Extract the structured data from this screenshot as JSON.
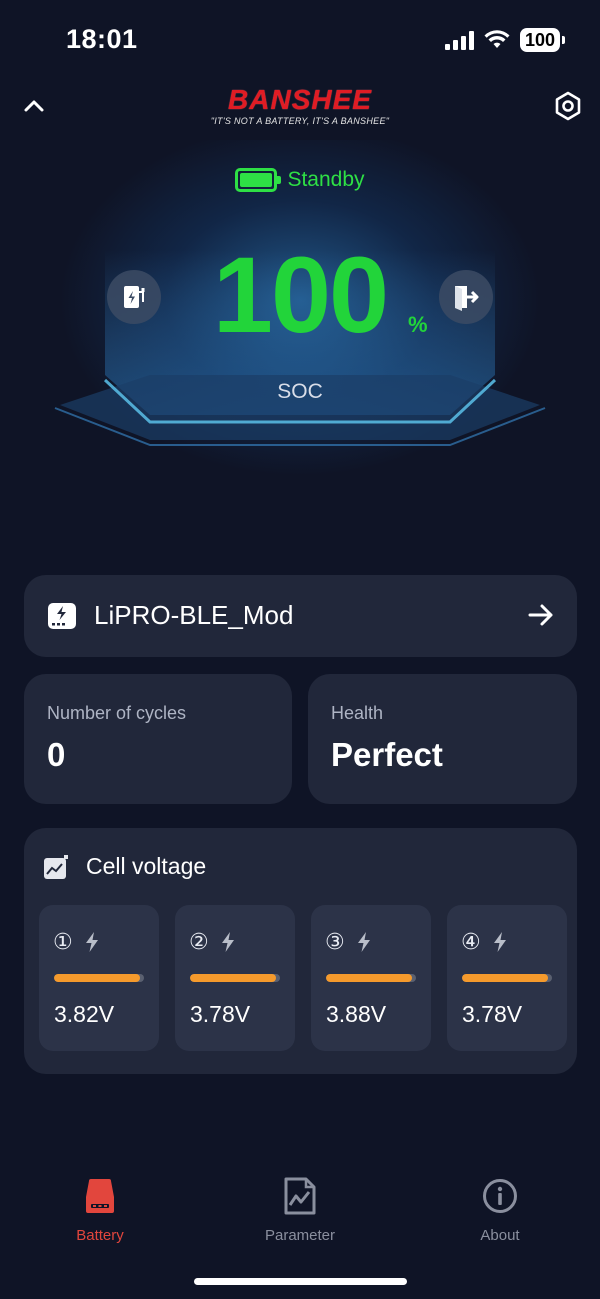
{
  "status_bar": {
    "time": "18:01",
    "battery_level": "100"
  },
  "brand": {
    "name": "BANSHEE",
    "tagline": "\"IT'S NOT A BATTERY, IT'S A BANSHEE\""
  },
  "hero": {
    "state": "Standby",
    "soc_value": "100",
    "soc_unit": "%",
    "soc_label": "SOC",
    "state_color": "#2ee045"
  },
  "device": {
    "name": "LiPRO-BLE_Mod"
  },
  "stats": {
    "cycles": {
      "label": "Number of cycles",
      "value": "0"
    },
    "health": {
      "label": "Health",
      "value": "Perfect"
    }
  },
  "cell_voltage": {
    "title": "Cell voltage",
    "cells": [
      {
        "index": "①",
        "voltage": "3.82V",
        "level": 0.95
      },
      {
        "index": "②",
        "voltage": "3.78V",
        "level": 0.95
      },
      {
        "index": "③",
        "voltage": "3.88V",
        "level": 0.95
      },
      {
        "index": "④",
        "voltage": "3.78V",
        "level": 0.95
      }
    ],
    "bar_color": "#f59a2c"
  },
  "tabs": [
    {
      "label": "Battery",
      "icon": "battery-icon",
      "active": true
    },
    {
      "label": "Parameter",
      "icon": "chart-image-icon",
      "active": false
    },
    {
      "label": "About",
      "icon": "info-icon",
      "active": false
    }
  ],
  "colors": {
    "accent": "#e2463d",
    "background": "#0f1426",
    "card": "#21273a"
  }
}
